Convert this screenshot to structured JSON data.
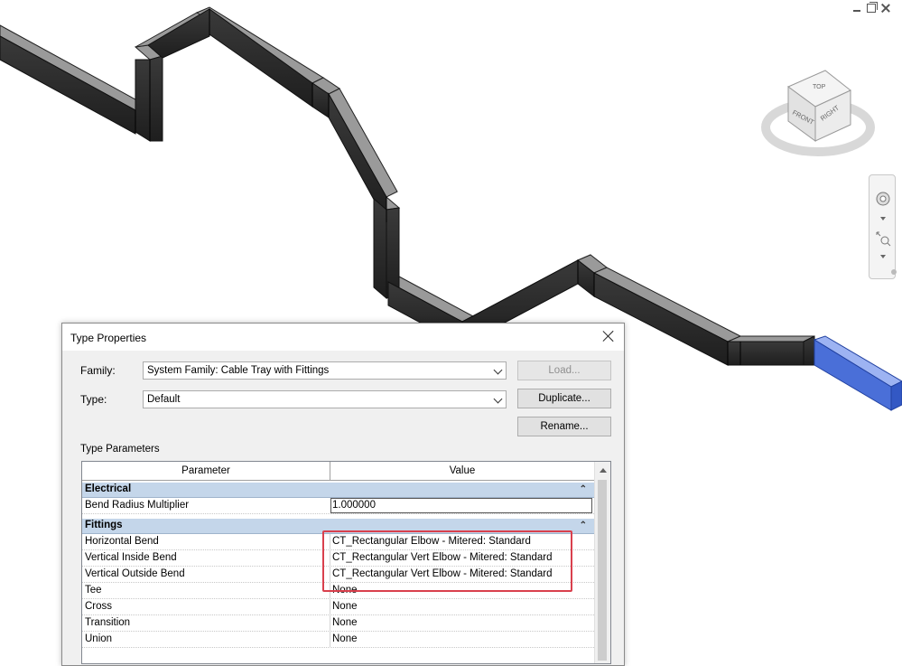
{
  "dialog": {
    "title": "Type Properties",
    "family_label": "Family:",
    "family_value": "System Family: Cable Tray with Fittings",
    "type_label": "Type:",
    "type_value": "Default",
    "load_label": "Load...",
    "duplicate_label": "Duplicate...",
    "rename_label": "Rename...",
    "section_label": "Type Parameters",
    "col_parameter": "Parameter",
    "col_value": "Value"
  },
  "groups": {
    "electrical": {
      "label": "Electrical",
      "rows": [
        {
          "parameter": "Bend Radius Multiplier",
          "value": "1.000000"
        }
      ]
    },
    "fittings": {
      "label": "Fittings",
      "rows": [
        {
          "parameter": "Horizontal Bend",
          "value": "CT_Rectangular Elbow - Mitered: Standard"
        },
        {
          "parameter": "Vertical Inside Bend",
          "value": "CT_Rectangular Vert Elbow - Mitered: Standard"
        },
        {
          "parameter": "Vertical Outside Bend",
          "value": "CT_Rectangular Vert Elbow - Mitered: Standard"
        },
        {
          "parameter": "Tee",
          "value": "None"
        },
        {
          "parameter": "Cross",
          "value": "None"
        },
        {
          "parameter": "Transition",
          "value": "None"
        },
        {
          "parameter": "Union",
          "value": "None"
        }
      ]
    }
  },
  "viewcube": {
    "top": "TOP",
    "front": "FRONT",
    "right": "RIGHT"
  },
  "colors": {
    "tray_dark": "#2e2e2e",
    "tray_top": "#8c8c8c",
    "tray_selected": "#4a6fd8",
    "annotation_red": "#e0423c",
    "group_header": "#c4d6ea"
  }
}
